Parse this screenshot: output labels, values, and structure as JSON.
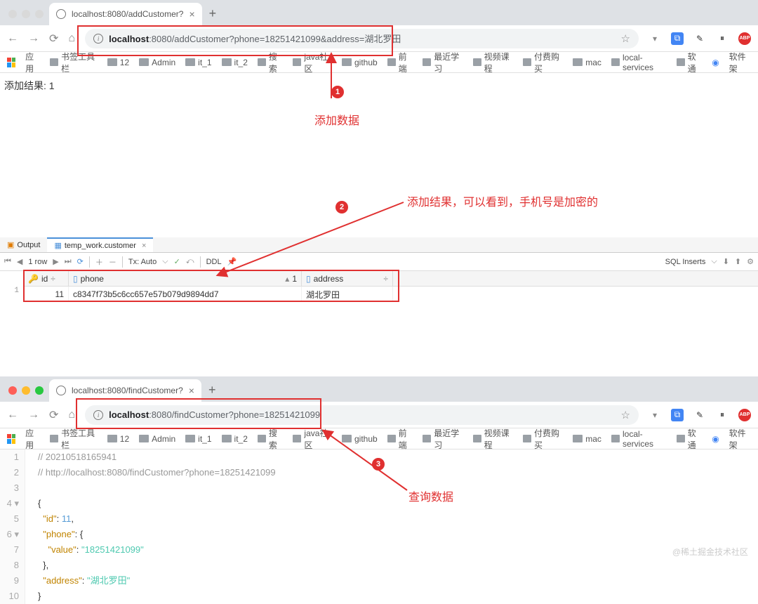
{
  "top": {
    "tab_title": "localhost:8080/addCustomer?",
    "url_host": "localhost",
    "url_path": ":8080/addCustomer?phone=18251421099&address=湖北罗田",
    "apps_label": "应用",
    "bookmarks": [
      "书签工具栏",
      "12",
      "Admin",
      "it_1",
      "it_2",
      "搜索",
      "java社区",
      "github",
      "前端",
      "最近学习",
      "视频课程",
      "付费购买",
      "mac",
      "local-services",
      "软通",
      "软件架"
    ],
    "page_text": "添加结果: 1"
  },
  "anno": {
    "b1": "1",
    "b2": "2",
    "b3": "3",
    "label1": "添加数据",
    "label2": "添加结果，可以看到，手机号是加密的",
    "label3": "查询数据"
  },
  "db": {
    "tab_output": "Output",
    "tab_table": "temp_work.customer",
    "rows_label": "1 row",
    "tx_label": "Tx: Auto",
    "ddl_label": "DDL",
    "sql_label": "SQL Inserts",
    "cols": {
      "id": "id",
      "phone": "phone",
      "one": "1",
      "address": "address"
    },
    "row_num": "1",
    "row": {
      "id": "11",
      "phone": "c8347f73b5c6cc657e57b079d9894dd7",
      "address": "湖北罗田"
    }
  },
  "bottom": {
    "tab_title": "localhost:8080/findCustomer?",
    "url_host": "localhost",
    "url_path": ":8080/findCustomer?phone=18251421099",
    "apps_label": "应用",
    "bookmarks": [
      "书签工具栏",
      "12",
      "Admin",
      "it_1",
      "it_2",
      "搜索",
      "java社区",
      "github",
      "前端",
      "最近学习",
      "视频课程",
      "付费购买",
      "mac",
      "local-services",
      "软通",
      "软件架"
    ]
  },
  "code": {
    "l1": "// 20210518165941",
    "l2": "// http://localhost:8080/findCustomer?phone=18251421099",
    "id_key": "\"id\"",
    "id_val": "11",
    "phone_key": "\"phone\"",
    "value_key": "\"value\"",
    "value_val": "\"18251421099\"",
    "addr_key": "\"address\"",
    "addr_val": "\"湖北罗田\""
  },
  "watermark": "@稀土掘金技术社区"
}
